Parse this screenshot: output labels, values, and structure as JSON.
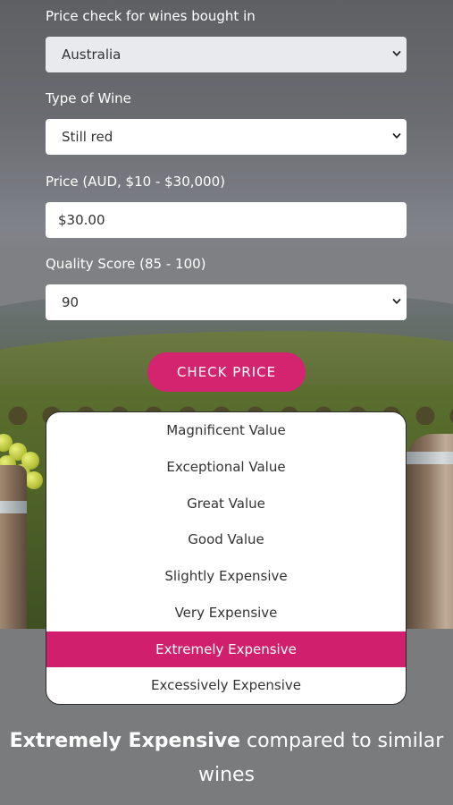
{
  "form": {
    "country_label": "Price check for wines bought in",
    "country_value": "Australia",
    "type_label": "Type of Wine",
    "type_value": "Still red",
    "price_label": "Price (AUD, $10 - $30,000)",
    "price_value": "$30.00",
    "score_label": "Quality Score (85 - 100)",
    "score_value": "90",
    "check_button": "CHECK PRICE"
  },
  "scale": {
    "items": [
      "Magnificent Value",
      "Exceptional Value",
      "Great Value",
      "Good Value",
      "Slightly Expensive",
      "Very Expensive",
      "Extremely Expensive",
      "Excessively Expensive"
    ],
    "selected": "Extremely Expensive",
    "accent_color": "#d01f6c"
  },
  "result": {
    "verdict": "Extremely Expensive",
    "suffix": " compared to similar wines"
  },
  "icons": {
    "dropdown": "chevron-down-icon"
  }
}
